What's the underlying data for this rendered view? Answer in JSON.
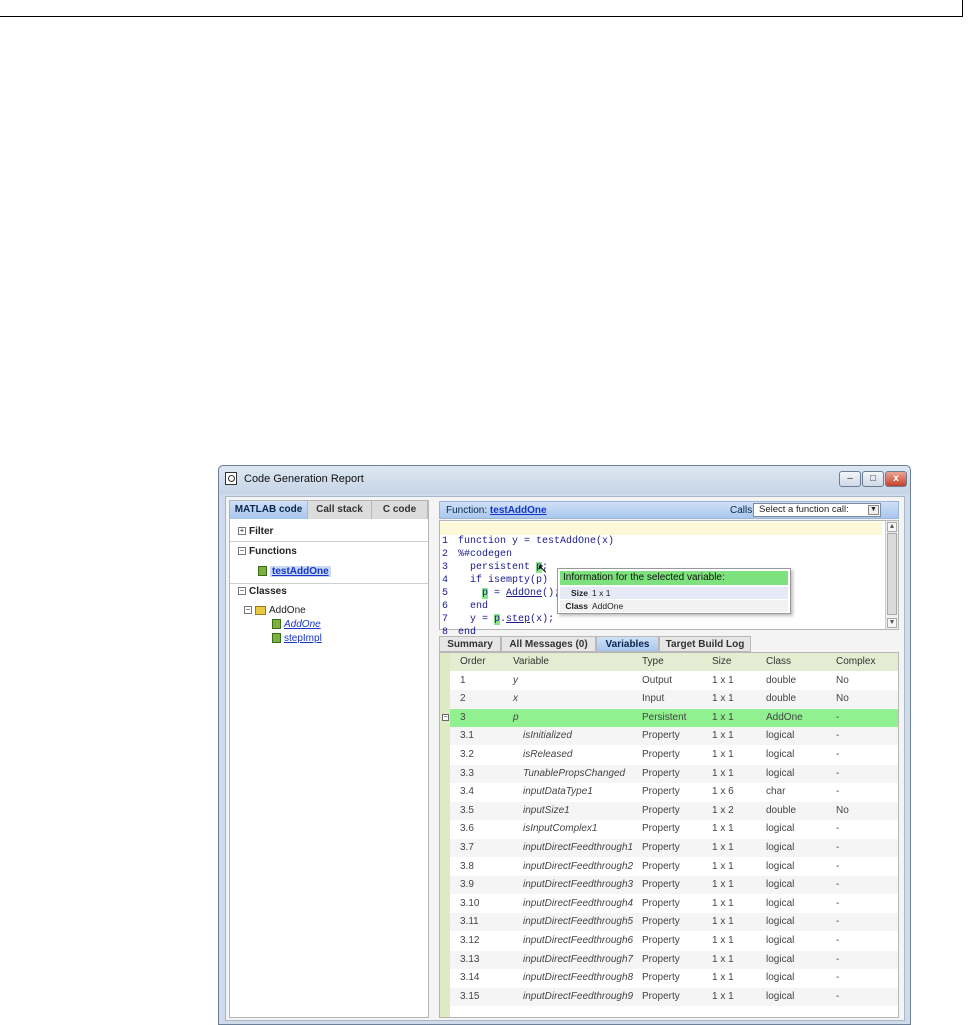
{
  "window": {
    "title": "Code Generation Report",
    "controls": {
      "minimize": "–",
      "maximize": "□",
      "close": "x"
    }
  },
  "left_panel": {
    "tabs": [
      {
        "label": "MATLAB code",
        "active": true
      },
      {
        "label": "Call stack",
        "active": false
      },
      {
        "label": "C code",
        "active": false
      }
    ],
    "sections": {
      "filter": "Filter",
      "functions": "Functions",
      "classes": "Classes"
    },
    "functions": [
      "testAddOne"
    ],
    "classes": [
      {
        "name": "AddOne",
        "methods": [
          "AddOne",
          "stepImpl"
        ]
      }
    ]
  },
  "function_bar": {
    "label": "Function:",
    "name": "testAddOne",
    "calls_label": "Calls",
    "calls_select": "Select a function call:"
  },
  "code": {
    "lines": [
      {
        "n": "1",
        "text": "function y = testAddOne(x)"
      },
      {
        "n": "2",
        "text": "%#codegen"
      },
      {
        "n": "3",
        "text": "  persistent p;"
      },
      {
        "n": "4",
        "text": "  if isempty(p)"
      },
      {
        "n": "5",
        "text": "    p = AddOne();"
      },
      {
        "n": "6",
        "text": "  end"
      },
      {
        "n": "7",
        "text": "  y = p.step(x);"
      },
      {
        "n": "8",
        "text": "end"
      }
    ]
  },
  "tooltip": {
    "title": "Information for the selected variable:",
    "rows": [
      {
        "key": "Size",
        "value": "1 x 1"
      },
      {
        "key": "Class",
        "value": "AddOne"
      }
    ]
  },
  "bottom_tabs": [
    {
      "label": "Summary",
      "active": false
    },
    {
      "label": "All Messages (0)",
      "active": false
    },
    {
      "label": "Variables",
      "active": true
    },
    {
      "label": "Target Build Log",
      "active": false
    }
  ],
  "variables": {
    "columns": [
      "Order",
      "Variable",
      "Type",
      "Size",
      "Class",
      "Complex"
    ],
    "rows": [
      {
        "order": "1",
        "variable": "y",
        "type": "Output",
        "size": "1 x 1",
        "class": "double",
        "complex": "No"
      },
      {
        "order": "2",
        "variable": "x",
        "type": "Input",
        "size": "1 x 1",
        "class": "double",
        "complex": "No"
      },
      {
        "order": "3",
        "variable": "p",
        "type": "Persistent",
        "size": "1 x 1",
        "class": "AddOne",
        "complex": "-"
      },
      {
        "order": "3.1",
        "variable": "isInitialized",
        "type": "Property",
        "size": "1 x 1",
        "class": "logical",
        "complex": "-"
      },
      {
        "order": "3.2",
        "variable": "isReleased",
        "type": "Property",
        "size": "1 x 1",
        "class": "logical",
        "complex": "-"
      },
      {
        "order": "3.3",
        "variable": "TunablePropsChanged",
        "type": "Property",
        "size": "1 x 1",
        "class": "logical",
        "complex": "-"
      },
      {
        "order": "3.4",
        "variable": "inputDataType1",
        "type": "Property",
        "size": "1 x 6",
        "class": "char",
        "complex": "-"
      },
      {
        "order": "3.5",
        "variable": "inputSize1",
        "type": "Property",
        "size": "1 x 2",
        "class": "double",
        "complex": "No"
      },
      {
        "order": "3.6",
        "variable": "isInputComplex1",
        "type": "Property",
        "size": "1 x 1",
        "class": "logical",
        "complex": "-"
      },
      {
        "order": "3.7",
        "variable": "inputDirectFeedthrough1",
        "type": "Property",
        "size": "1 x 1",
        "class": "logical",
        "complex": "-"
      },
      {
        "order": "3.8",
        "variable": "inputDirectFeedthrough2",
        "type": "Property",
        "size": "1 x 1",
        "class": "logical",
        "complex": "-"
      },
      {
        "order": "3.9",
        "variable": "inputDirectFeedthrough3",
        "type": "Property",
        "size": "1 x 1",
        "class": "logical",
        "complex": "-"
      },
      {
        "order": "3.10",
        "variable": "inputDirectFeedthrough4",
        "type": "Property",
        "size": "1 x 1",
        "class": "logical",
        "complex": "-"
      },
      {
        "order": "3.11",
        "variable": "inputDirectFeedthrough5",
        "type": "Property",
        "size": "1 x 1",
        "class": "logical",
        "complex": "-"
      },
      {
        "order": "3.12",
        "variable": "inputDirectFeedthrough6",
        "type": "Property",
        "size": "1 x 1",
        "class": "logical",
        "complex": "-"
      },
      {
        "order": "3.13",
        "variable": "inputDirectFeedthrough7",
        "type": "Property",
        "size": "1 x 1",
        "class": "logical",
        "complex": "-"
      },
      {
        "order": "3.14",
        "variable": "inputDirectFeedthrough8",
        "type": "Property",
        "size": "1 x 1",
        "class": "logical",
        "complex": "-"
      },
      {
        "order": "3.15",
        "variable": "inputDirectFeedthrough9",
        "type": "Property",
        "size": "1 x 1",
        "class": "logical",
        "complex": "-"
      }
    ]
  },
  "colors": {
    "selected_row": "#91f08f",
    "tab_active": "#a9c7ee",
    "link": "#1736c9"
  }
}
